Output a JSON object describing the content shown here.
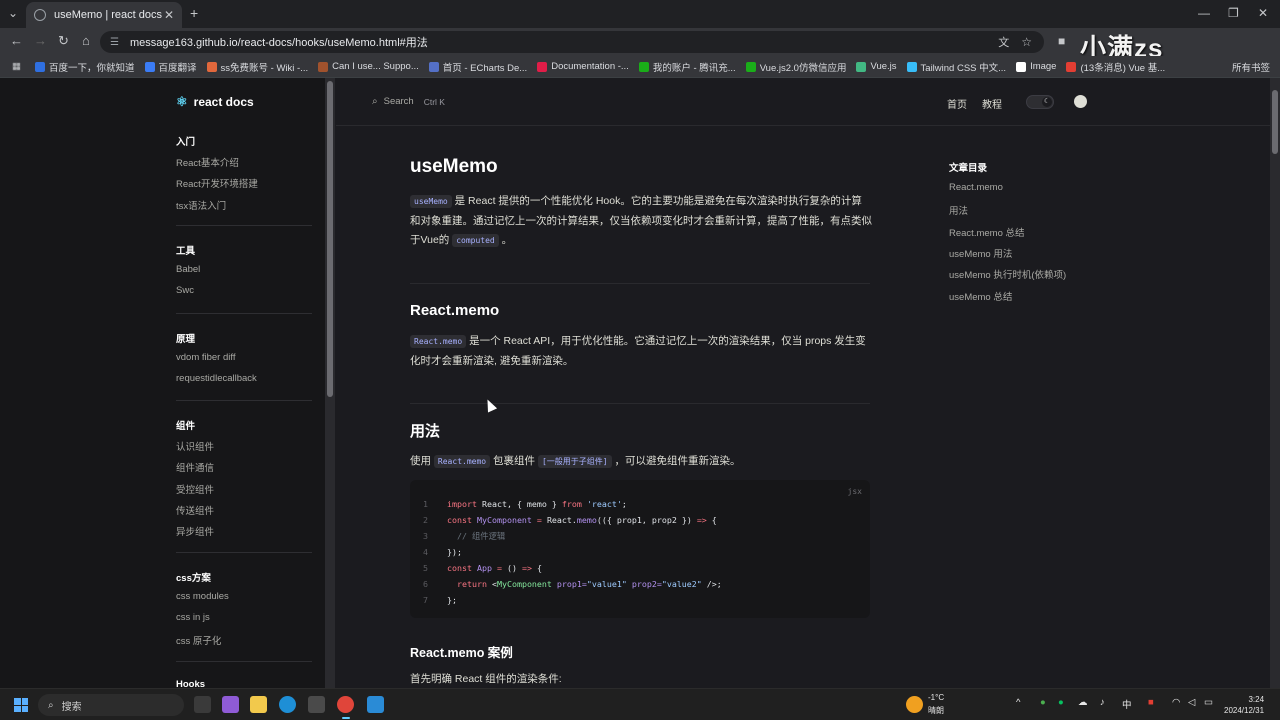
{
  "browser": {
    "tab_title": "useMemo | react docs",
    "new_tab": "+",
    "url": "message163.github.io/react-docs/hooks/useMemo.html#用法",
    "bookmarks": [
      {
        "label": "百度一下，你就知道",
        "color": "#2f6fe0"
      },
      {
        "label": "百度翻译",
        "color": "#3b7cf5"
      },
      {
        "label": "ss免费账号 - Wiki -...",
        "color": "#e2683c"
      },
      {
        "label": "Can I use... Suppo...",
        "color": "#a0522d"
      },
      {
        "label": "首页 - ECharts De...",
        "color": "#5470c6"
      },
      {
        "label": "Documentation -...",
        "color": "#e11d48"
      },
      {
        "label": "我的账户 - 腾讯充...",
        "color": "#1aad19"
      },
      {
        "label": "Vue.js2.0仿微信应用",
        "color": "#1aad19"
      },
      {
        "label": "Vue.js",
        "color": "#42b883"
      },
      {
        "label": "Tailwind CSS 中文...",
        "color": "#38bdf8"
      },
      {
        "label": "Image",
        "color": "#ffffff"
      },
      {
        "label": "(13条消息) Vue 基...",
        "color": "#e33e33"
      }
    ],
    "all_bookmarks": "所有书签",
    "watermark": "小满zs"
  },
  "sidebar": {
    "logo": "react docs",
    "sections": [
      {
        "title": "入门",
        "items": [
          "React基本介绍",
          "React开发环境搭建",
          "tsx语法入门"
        ]
      },
      {
        "title": "工具",
        "items": [
          "Babel",
          "Swc"
        ]
      },
      {
        "title": "原理",
        "items": [
          "vdom fiber diff",
          "requestidlecallback"
        ]
      },
      {
        "title": "组件",
        "items": [
          "认识组件",
          "组件通信",
          "受控组件",
          "传送组件",
          "异步组件"
        ]
      },
      {
        "title": "css方案",
        "items": [
          "css modules",
          "css in js",
          "css 原子化"
        ]
      },
      {
        "title": "Hooks",
        "items": []
      }
    ]
  },
  "topnav": {
    "search_label": "Search",
    "search_kbd": "Ctrl K",
    "link_home": "首页",
    "link_tutorial": "教程"
  },
  "article": {
    "title": "useMemo",
    "intro_code": "useMemo",
    "intro_text": " 是 React 提供的一个性能优化 Hook。它的主要功能是避免在每次渲染时执行复杂的计算和对象重建。通过记忆上一次的计算结果，仅当依赖项变化时才会重新计算，提高了性能，有点类似于Vue的 ",
    "intro_code2": "computed",
    "intro_end": " 。",
    "h2_memo": "React.memo",
    "memo_code": "React.memo",
    "memo_text": " 是一个 React API，用于优化性能。它通过记忆上一次的渲染结果，仅当 props 发生变化时才会重新渲染, 避免重新渲染。",
    "h2_usage": "用法",
    "usage_pre": "使用 ",
    "usage_code": "React.memo",
    "usage_mid": " 包裹组件 ",
    "usage_code2": "[一般用于子组件]",
    "usage_end": " ，可以避免组件重新渲染。",
    "code_lang": "jsx",
    "code_lines": [
      "1",
      "2",
      "3",
      "4",
      "5",
      "6",
      "7"
    ],
    "h3_case": "React.memo 案例",
    "case_text": "首先明确 React 组件的渲染条件:"
  },
  "code": {
    "l1_a": "import",
    "l1_b": " React, { memo } ",
    "l1_c": "from",
    "l1_d": " 'react'",
    "l1_e": ";",
    "l2_a": "const",
    "l2_b": " MyComponent",
    "l2_c": " = ",
    "l2_d": "React.",
    "l2_e": "memo",
    "l2_f": "(({ prop1, prop2 }) ",
    "l2_g": "=>",
    "l2_h": " {",
    "l3": "  // 组件逻辑",
    "l4": "});",
    "l5_a": "const",
    "l5_b": " App",
    "l5_c": " = ",
    "l5_d": "() ",
    "l5_e": "=>",
    "l5_f": " {",
    "l6_a": "  return ",
    "l6_b": "<",
    "l6_c": "MyComponent",
    "l6_d": " prop1=",
    "l6_e": "\"value1\"",
    "l6_f": " prop2=",
    "l6_g": "\"value2\"",
    "l6_h": " />;",
    "l7": "};"
  },
  "toc": {
    "title": "文章目录",
    "items": [
      "React.memo",
      "用法",
      "React.memo 总结",
      "useMemo 用法",
      "useMemo 执行时机(依赖项)",
      "useMemo 总结"
    ]
  },
  "taskbar": {
    "search": "搜索",
    "weather_temp": "-1°C",
    "weather_desc": "晴朗",
    "ime": "中",
    "time": "3:24",
    "date": "2024/12/31"
  }
}
